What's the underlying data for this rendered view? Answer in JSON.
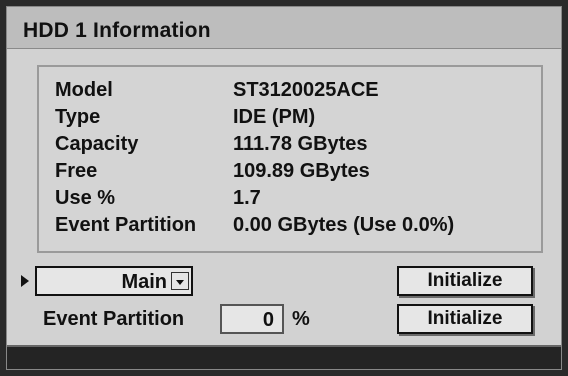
{
  "window": {
    "title": "HDD 1 Information"
  },
  "info": [
    {
      "label": "Model",
      "value": "ST3120025ACE"
    },
    {
      "label": "Type",
      "value": "IDE (PM)"
    },
    {
      "label": "Capacity",
      "value": "111.78 GBytes"
    },
    {
      "label": "Free",
      "value": "109.89 GBytes"
    },
    {
      "label": "Use %",
      "value": "1.7"
    },
    {
      "label": "Event Partition",
      "value": "0.00 GBytes (Use 0.0%)"
    }
  ],
  "partition_select": {
    "value": "Main"
  },
  "event_partition": {
    "label": "Event Partition",
    "value": "0",
    "unit": "%"
  },
  "buttons": {
    "initialize_main": "Initialize",
    "initialize_event": "Initialize"
  }
}
